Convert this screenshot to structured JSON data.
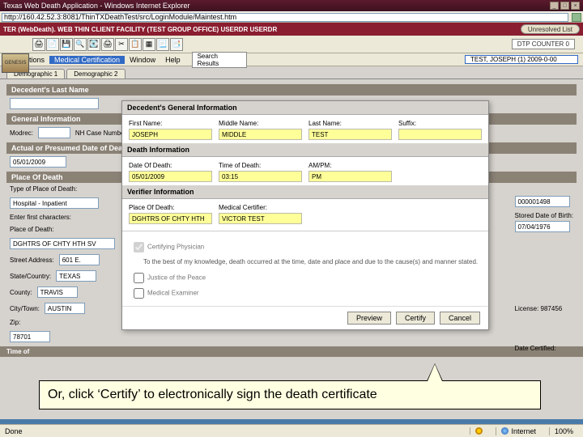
{
  "window": {
    "title": "Texas Web Death Application - Windows Internet Explorer",
    "url": "http://160.42.52.3:8081/ThinTXDeathTest/src/LoginModule/Maintest.htm"
  },
  "topband": {
    "title": "TER (WebDeath). WEB THIN CLIENT FACILITY (TEST GROUP OFFICE) USERDR USERDR",
    "unresolved": "Unresolved List",
    "genesis": "GENESIS"
  },
  "toolbar": {
    "dtp": "DTP COUNTER 0"
  },
  "menu": {
    "functions": "Functions",
    "medcert": "Medical Certification",
    "window": "Window",
    "help": "Help",
    "search": "Search Results",
    "caseSel": "TEST, JOSEPH (1) 2009-0-00"
  },
  "tabs": {
    "demo1": "Demographic 1",
    "demo2": "Demographic 2"
  },
  "bg": {
    "secDecedent": "Decedent's Last Name",
    "secGeneral": "General Information",
    "modrecLbl": "Modrec:",
    "nhLbl": "NH Case Number:",
    "secActual": "Actual or Presumed Date of Death",
    "actualDate": "05/01/2009",
    "secPlace": "Place Of Death",
    "typeLbl": "Type of Place of Death:",
    "typeVal": "Hospital - Inpatient",
    "firstLbl": "Enter first characters:",
    "placeLbl": "Place of Death:",
    "placeVal": "DGHTRS OF CHTY HTH SV",
    "streetLbl": "Street Address:",
    "streetVal": "601 E.",
    "stateLbl": "State/Country:",
    "stateVal": "TEXAS",
    "countyLbl": "County:",
    "countyVal": "TRAVIS",
    "cityLbl": "City/Town:",
    "cityVal": "AUSTIN",
    "zipLbl": "Zip:",
    "zipVal": "78701",
    "timeLbl": "Time of",
    "rightId": "000001498",
    "rightDateLbl": "Stored Date of Birth:",
    "rightDate": "07/04/1976",
    "licenseLbl": "License: 987456",
    "dateCertLbl": "Date Certified:"
  },
  "modal": {
    "secGen": "Decedent's General Information",
    "fnLbl": "First Name:",
    "mnLbl": "Middle Name:",
    "lnLbl": "Last Name:",
    "sxLbl": "Suffix:",
    "fn": "JOSEPH",
    "mn": "MIDDLE",
    "ln": "TEST",
    "sx": "",
    "secDeath": "Death Information",
    "dodLbl": "Date Of Death:",
    "todLbl": "Time of Death:",
    "ampmLbl": "AM/PM:",
    "dod": "05/01/2009",
    "tod": "03:15",
    "ampm": "PM",
    "secVer": "Verifier Information",
    "podLbl": "Place Of Death:",
    "mcLbl": "Medical Certifier:",
    "pod": "DGHTRS OF CHTY HTH",
    "mc": "VICTOR TEST",
    "cp": "Certifying Physician",
    "cpText": "To the best of my knowledge, death occurred at the time, date and place and due to the cause(s) and manner stated.",
    "jp": "Justice of the Peace",
    "me": "Medical Examiner",
    "preview": "Preview",
    "certify": "Certify",
    "cancel": "Cancel"
  },
  "callout": {
    "text": "Or, click ‘Certify’ to electronically sign the death certificate"
  },
  "status": {
    "done": "Done",
    "zone": "Internet",
    "zoom": "100%"
  }
}
